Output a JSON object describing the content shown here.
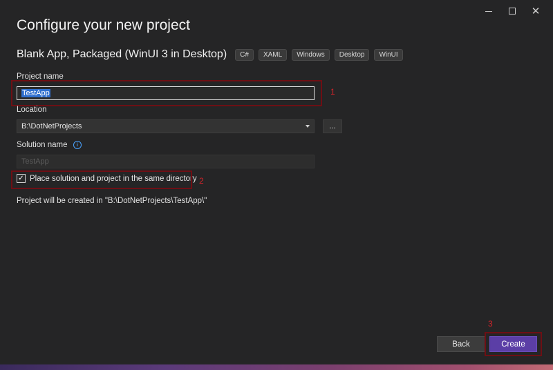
{
  "window": {
    "title": "Configure your new project",
    "controls": {
      "minimize_icon": "minimize-icon",
      "maximize_icon": "maximize-icon",
      "close_glyph": "✕"
    }
  },
  "template": {
    "name": "Blank App, Packaged (WinUI 3 in Desktop)",
    "tags": [
      "C#",
      "XAML",
      "Windows",
      "Desktop",
      "WinUI"
    ]
  },
  "form": {
    "project_name_label": "Project name",
    "project_name_value": "TestApp",
    "location_label": "Location",
    "location_value": "B:\\DotNetProjects",
    "browse_label": "...",
    "solution_name_label": "Solution name",
    "solution_name_value": "TestApp",
    "info_glyph": "i",
    "same_dir_label": "Place solution and project in the same directory",
    "same_dir_checked": true,
    "check_glyph": "✓",
    "path_note": "Project will be created in \"B:\\DotNetProjects\\TestApp\\\""
  },
  "annotations": {
    "step1": "1",
    "step2": "2",
    "step3": "3",
    "highlight_color": "#6e0f14",
    "number_color": "#d2242a"
  },
  "footer": {
    "back_label": "Back",
    "create_label": "Create"
  },
  "colors": {
    "background": "#252526",
    "accent": "#5b3ea6",
    "selection": "#2f6fcf"
  }
}
